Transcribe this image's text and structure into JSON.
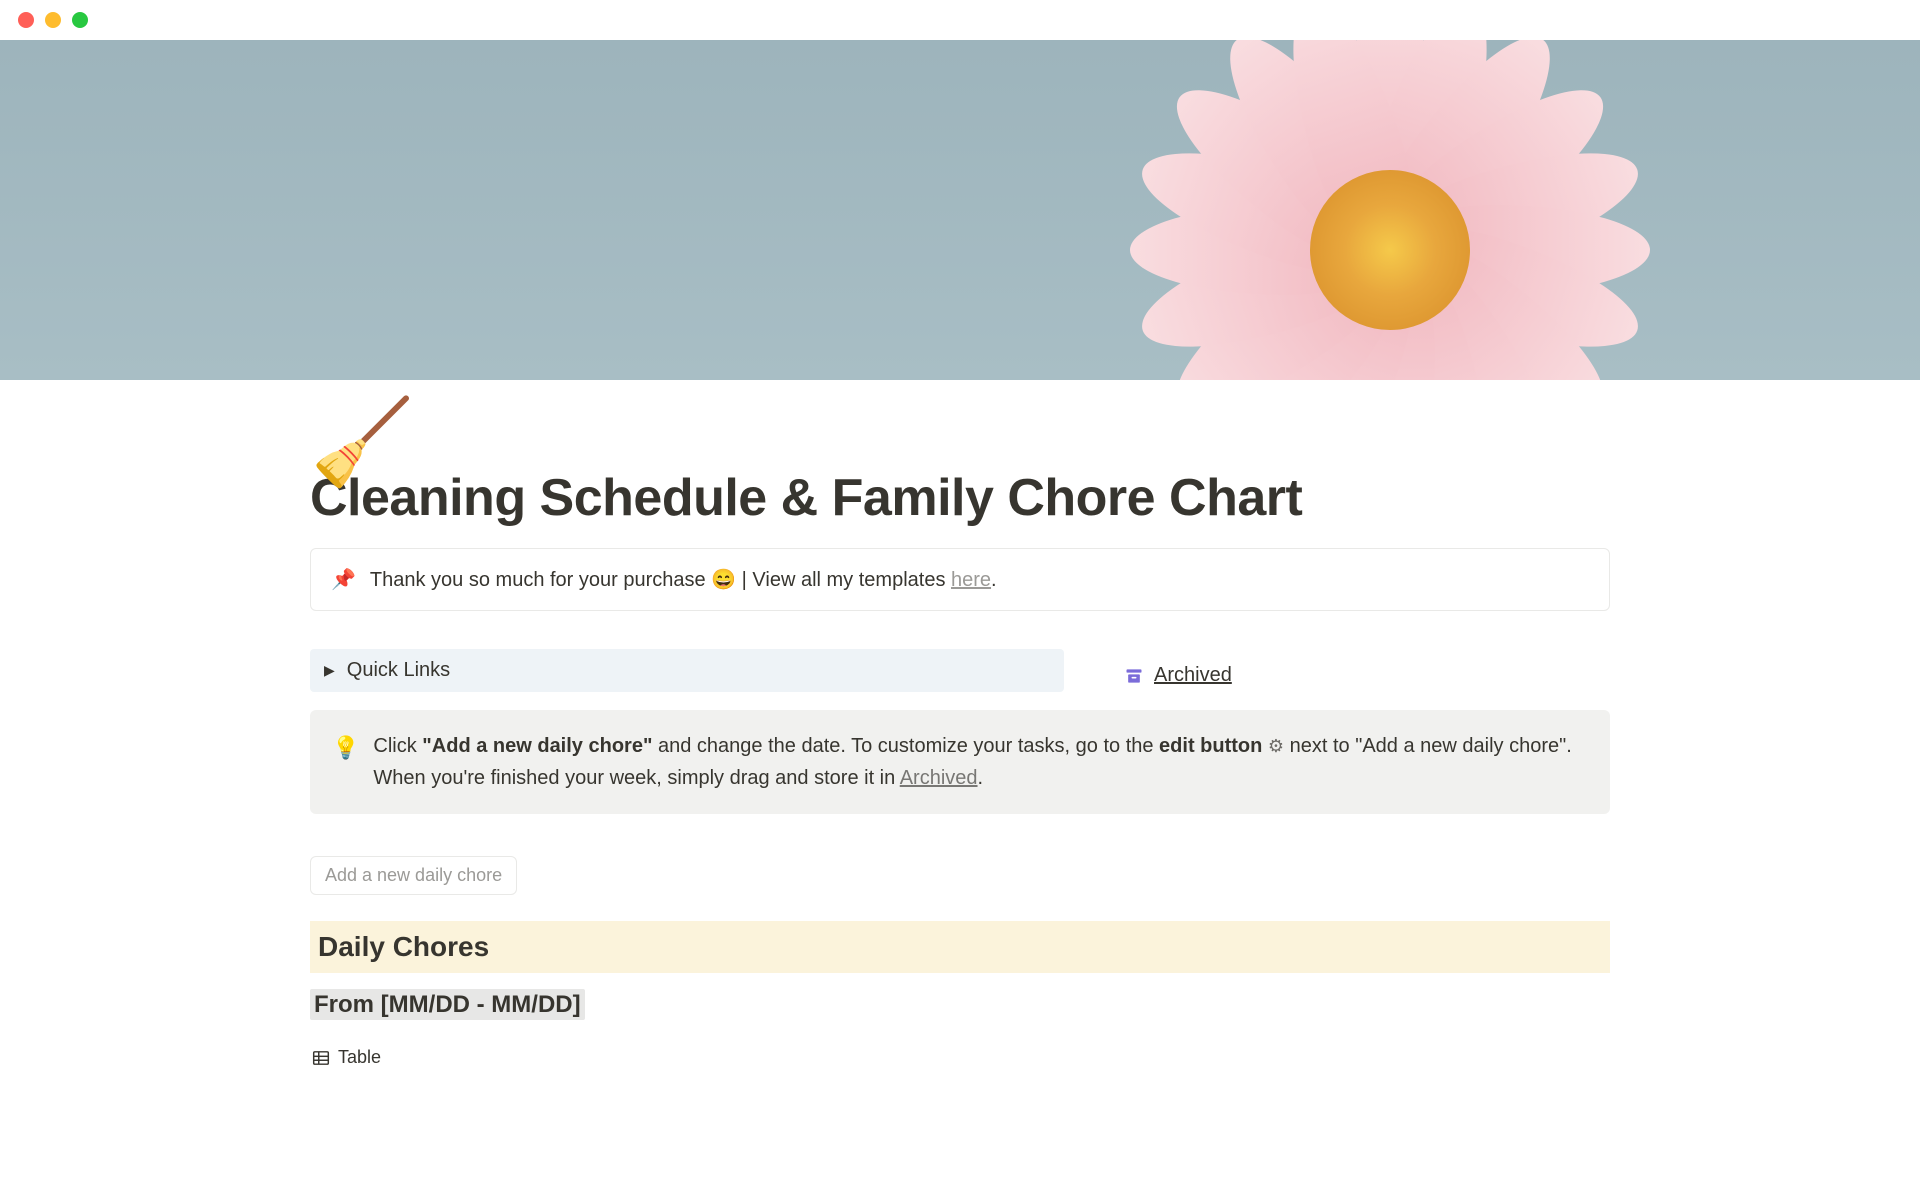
{
  "page": {
    "icon_emoji": "🧹",
    "title": "Cleaning Schedule & Family Chore Chart"
  },
  "callout_pin": {
    "emoji": "📌",
    "text_prefix": "Thank you so much for your purchase ",
    "emoji_inline": "😄",
    "text_middle": " | View all my templates ",
    "link_text": "here",
    "text_suffix": "."
  },
  "quick_links": {
    "label": "Quick Links"
  },
  "archived": {
    "label": "Archived"
  },
  "callout_tip": {
    "bulb": "💡",
    "t1": "Click ",
    "bold1": "\"Add a new daily chore\"",
    "t2": " and change the date. To customize your tasks, go to the",
    "bold2": " edit button ",
    "gear": "⚙",
    "t3": " next to \"Add a new daily chore\". When you're finished your week, simply drag and store it in ",
    "link": "Archived",
    "t4": "."
  },
  "buttons": {
    "add_chore": "Add a new daily chore"
  },
  "sections": {
    "daily_chores": "Daily Chores",
    "date_range": "From [MM/DD - MM/DD]"
  },
  "views": {
    "table": "Table"
  }
}
